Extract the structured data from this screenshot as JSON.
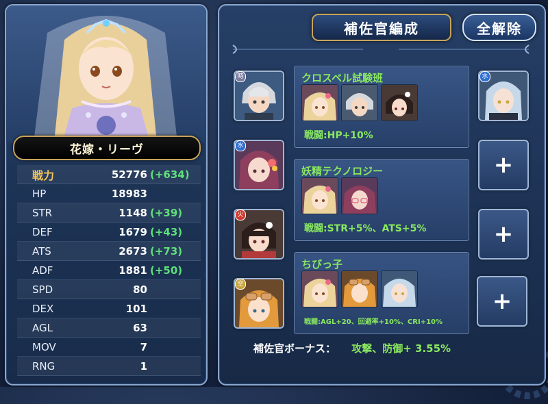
{
  "character": {
    "name": "花嫁・リーヴ"
  },
  "stats": [
    {
      "label": "戦力",
      "value": "52776",
      "bonus": "(+634)"
    },
    {
      "label": "HP",
      "value": "18983",
      "bonus": ""
    },
    {
      "label": "STR",
      "value": "1148",
      "bonus": "(+39)"
    },
    {
      "label": "DEF",
      "value": "1679",
      "bonus": "(+43)"
    },
    {
      "label": "ATS",
      "value": "2673",
      "bonus": "(+73)"
    },
    {
      "label": "ADF",
      "value": "1881",
      "bonus": "(+50)"
    },
    {
      "label": "SPD",
      "value": "80",
      "bonus": ""
    },
    {
      "label": "DEX",
      "value": "101",
      "bonus": ""
    },
    {
      "label": "AGL",
      "value": "63",
      "bonus": ""
    },
    {
      "label": "MOV",
      "value": "7",
      "bonus": ""
    },
    {
      "label": "RNG",
      "value": "1",
      "bonus": ""
    }
  ],
  "header": {
    "title": "補佐官編成",
    "clear_all": "全解除"
  },
  "slots": {
    "left": [
      {
        "badge": "時"
      },
      {
        "badge": "水"
      },
      {
        "badge": "火"
      },
      {
        "badge": "空"
      }
    ],
    "right_first_badge": "水",
    "plus_label": "+"
  },
  "groups": [
    {
      "title": "クロスベル試験班",
      "bonus": "戦闘:HP+10%"
    },
    {
      "title": "妖精テクノロジー",
      "bonus": "戦闘:STR+5%、ATS+5%"
    },
    {
      "title": "ちびっ子",
      "bonus": "戦闘:AGL+20、回避率+10%、CRI+10%"
    }
  ],
  "support_bonus": {
    "label": "補佐官ボーナス：",
    "value": "攻撃、防御+ 3.55%"
  },
  "colors": {
    "bonus_green": "#5fe07a",
    "power_gold": "#f2c35a",
    "group_text_green": "#8ae85f"
  }
}
